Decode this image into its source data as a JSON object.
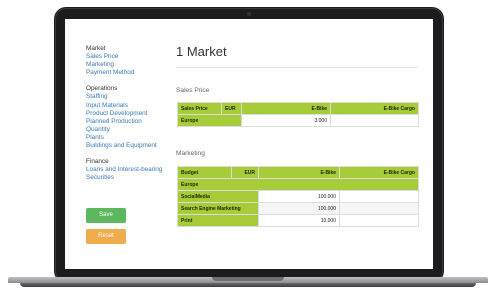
{
  "sidebar": {
    "market": {
      "heading": "Market",
      "links": [
        "Sales Price",
        "Marketing",
        "Payment Method"
      ]
    },
    "operations": {
      "heading": "Operations",
      "links": [
        "Staffing",
        "Input Materials",
        "Product Development",
        "Planned Production",
        "Quantity",
        "Plants",
        "Buildings and Equipment"
      ]
    },
    "finance": {
      "heading": "Finance",
      "links": [
        "Loans and Interest-bearing",
        "Securities"
      ]
    },
    "save_label": "Save",
    "reset_label": "Reset"
  },
  "page_title": "1 Market",
  "sales_price": {
    "heading": "Sales Price",
    "columns": [
      "Sales Price",
      "EUR",
      "E-Bike",
      "E-Bike Cargo"
    ],
    "rows": [
      {
        "label": "Europe",
        "ebike": "3.000",
        "cargo": ""
      }
    ]
  },
  "marketing": {
    "heading": "Marketing",
    "columns": [
      "Budget",
      "EUR",
      "E-Bike",
      "E-Bike Cargo"
    ],
    "region": "Europe",
    "rows": [
      {
        "label": "SocialMedia",
        "ebike": "100.000",
        "cargo": ""
      },
      {
        "label": "Search Engine Marketing",
        "ebike": "100.000",
        "cargo": ""
      },
      {
        "label": "Print",
        "ebike": "10.000",
        "cargo": ""
      }
    ]
  },
  "colors": {
    "accent_green": "#a6cc3a",
    "link_blue": "#3a79b8",
    "save_green": "#5cb85c",
    "reset_orange": "#f0ad4e"
  }
}
